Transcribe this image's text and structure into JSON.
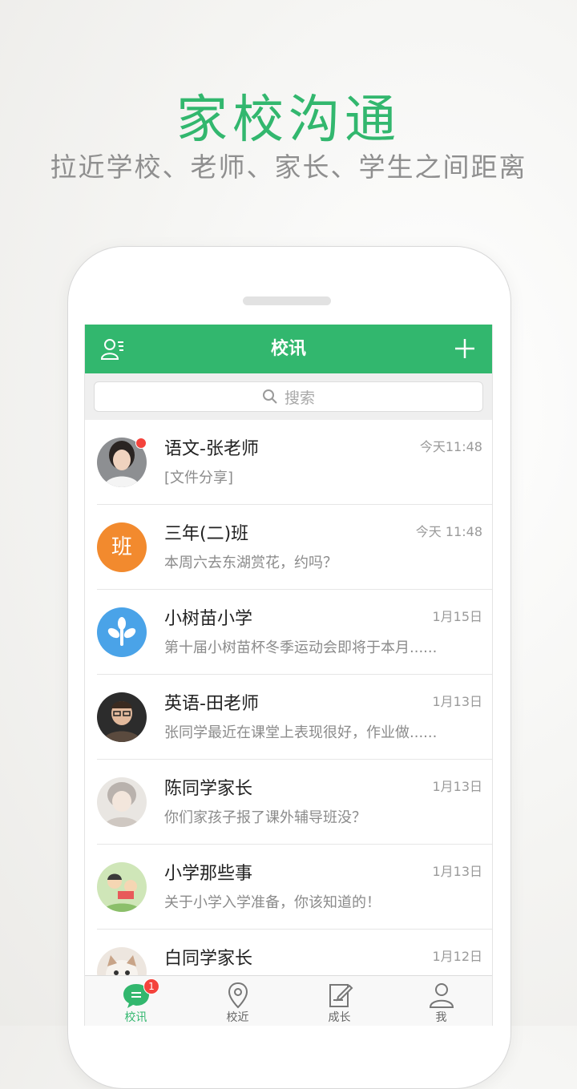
{
  "hero": {
    "title": "家校沟通",
    "subtitle": "拉近学校、老师、家长、学生之间距离"
  },
  "app": {
    "accent": "#32b76e",
    "header": {
      "title": "校讯",
      "left_icon": "contacts-icon",
      "right_icon": "plus-icon"
    },
    "search": {
      "placeholder": "搜索",
      "icon": "search-icon"
    },
    "conversations": [
      {
        "name": "语文-张老师",
        "time": "今天11:48",
        "preview": "[文件分享]",
        "avatar": "teacher-photo",
        "unread_dot": true
      },
      {
        "name": "三年(二)班",
        "time": "今天 11:48",
        "preview": "本周六去东湖赏花，约吗？",
        "avatar_text": "班",
        "avatar_color": "#f28a2e"
      },
      {
        "name": "小树苗小学",
        "time": "1月15日",
        "preview": "第十届小树苗杯冬季运动会即将于本月......",
        "avatar": "sprout-icon",
        "avatar_color": "#4aa3e8"
      },
      {
        "name": "英语-田老师",
        "time": "1月13日",
        "preview": "张同学最近在课堂上表现很好，作业做......",
        "avatar": "teacher-photo"
      },
      {
        "name": "陈同学家长",
        "time": "1月13日",
        "preview": "你们家孩子报了课外辅导班没？",
        "avatar": "parent-photo"
      },
      {
        "name": "小学那些事",
        "time": "1月13日",
        "preview": "关于小学入学准备，你该知道的！",
        "avatar": "cartoon-photo"
      },
      {
        "name": "白同学家长",
        "time": "1月12日",
        "preview": "",
        "avatar": "cat-photo"
      }
    ],
    "tabs": [
      {
        "label": "校讯",
        "icon": "chat-icon",
        "badge": "1",
        "active": true
      },
      {
        "label": "校近",
        "icon": "location-pin-icon"
      },
      {
        "label": "成长",
        "icon": "notebook-edit-icon"
      },
      {
        "label": "我",
        "icon": "person-icon"
      }
    ]
  }
}
